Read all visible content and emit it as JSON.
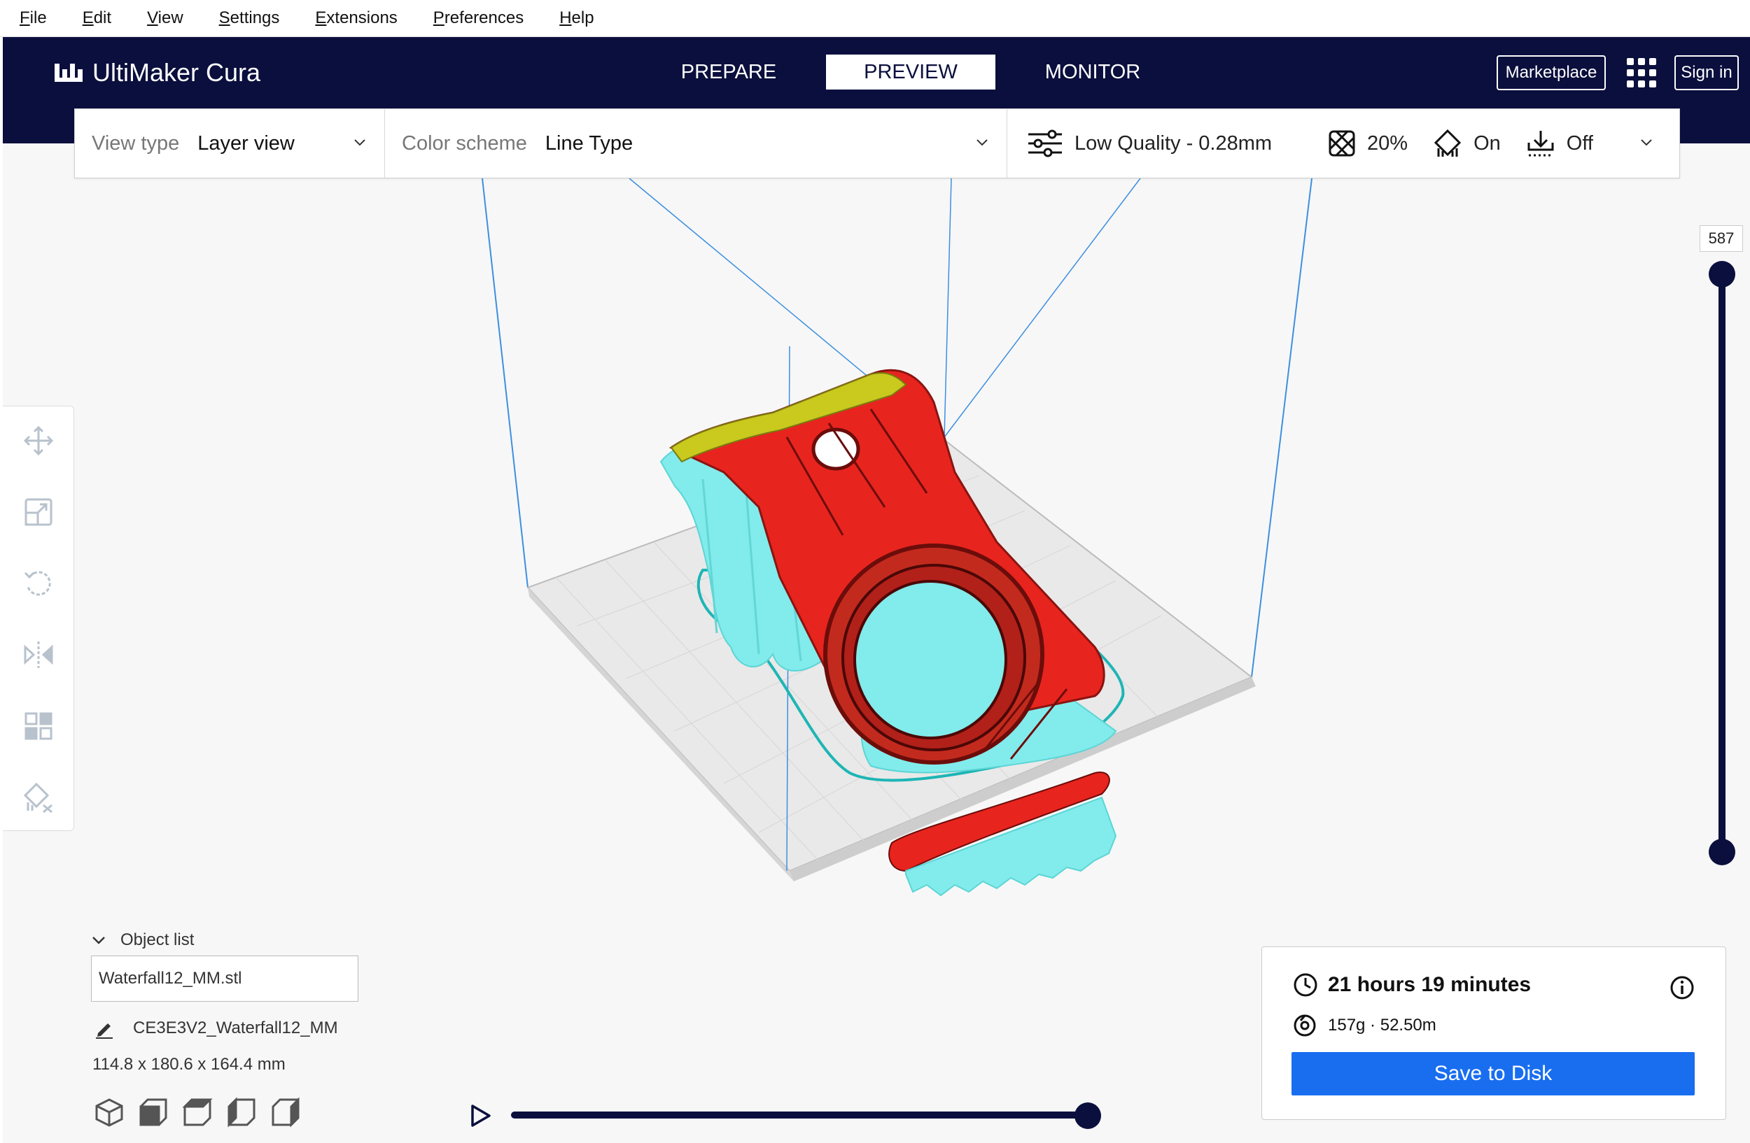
{
  "menu": {
    "items": [
      {
        "first": "F",
        "rest": "ile"
      },
      {
        "first": "E",
        "rest": "dit"
      },
      {
        "first": "V",
        "rest": "iew"
      },
      {
        "first": "S",
        "rest": "ettings"
      },
      {
        "first": "E",
        "rest": "xtensions"
      },
      {
        "first": "P",
        "rest": "references"
      },
      {
        "first": "H",
        "rest": "elp"
      }
    ]
  },
  "header": {
    "app_name": "UltiMaker Cura",
    "stages": [
      "PREPARE",
      "PREVIEW",
      "MONITOR"
    ],
    "active_stage": "PREVIEW",
    "marketplace_label": "Marketplace",
    "signin_label": "Sign in",
    "brand_color": "#0a0f3d"
  },
  "toolbar": {
    "view_type_label": "View type",
    "view_type_value": "Layer view",
    "color_scheme_label": "Color scheme",
    "color_scheme_value": "Line Type",
    "quality": "Low Quality - 0.28mm",
    "infill": "20%",
    "support": "On",
    "adhesion": "Off"
  },
  "layer_slider": {
    "top_layer": "587"
  },
  "object_list": {
    "toggle_label": "Object list",
    "file_name": "Waterfall12_MM.stl",
    "object_name": "CE3E3V2_Waterfall12_MM",
    "dimensions": "114.8 x 180.6 x 164.4 mm"
  },
  "print_info": {
    "time": "21 hours 19 minutes",
    "material": "157g · 52.50m",
    "save_label": "Save to Disk",
    "button_color": "#196ef0"
  }
}
